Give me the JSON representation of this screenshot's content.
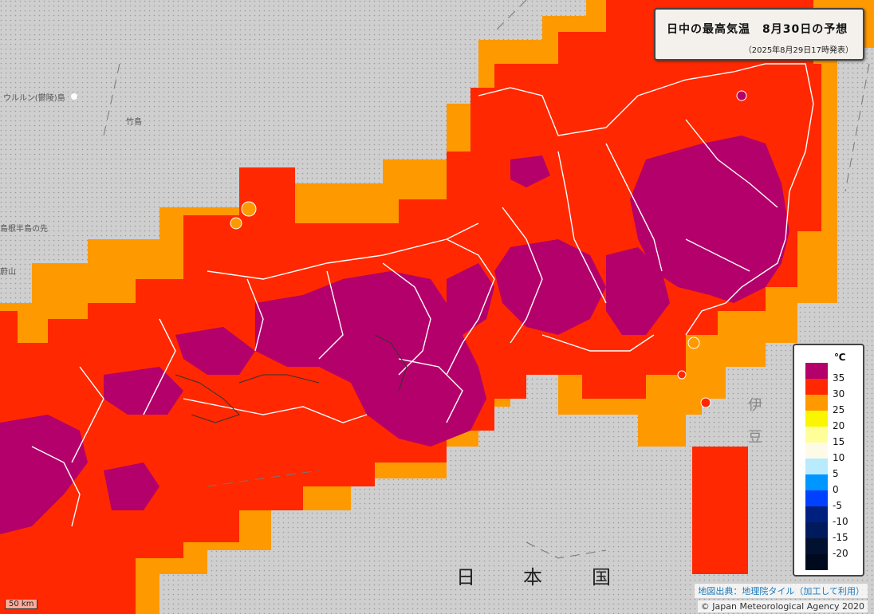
{
  "title": {
    "main": "日中の最高気温　8月30日の予想",
    "issued": "（2025年8月29日17時発表）"
  },
  "legend": {
    "unit": "℃",
    "items": [
      {
        "label": "35",
        "color": "#b4006a"
      },
      {
        "label": "30",
        "color": "#ff2800"
      },
      {
        "label": "25",
        "color": "#ff9900"
      },
      {
        "label": "20",
        "color": "#faf500"
      },
      {
        "label": "15",
        "color": "#ffff99"
      },
      {
        "label": "10",
        "color": "#fdfbe8"
      },
      {
        "label": "5",
        "color": "#b9ebff"
      },
      {
        "label": "0",
        "color": "#0096ff"
      },
      {
        "label": "-5",
        "color": "#0041ff"
      },
      {
        "label": "-10",
        "color": "#002080"
      },
      {
        "label": "-15",
        "color": "#001a5e"
      },
      {
        "label": "-20",
        "color": "#00122f"
      },
      {
        "label": "",
        "color": "#000a1e"
      }
    ]
  },
  "places": {
    "sea": [
      "日",
      "本",
      "国"
    ],
    "izu": [
      "伊",
      "豆"
    ],
    "small": [
      "ウルルン(鬱陵)島",
      "竹島",
      "島根半島の先",
      "蔚山"
    ]
  },
  "credits": {
    "tiles": "地図出典：地理院タイル（加工して利用）",
    "agency": "© Japan Meteorological Agency 2020"
  },
  "scale_label": "50 km",
  "colors": {
    "sea": "#cfcfcf",
    "band_outer": "#ff9900",
    "band_mid": "#ff2800",
    "band_hot": "#b4006a",
    "border": "#ffffff"
  }
}
